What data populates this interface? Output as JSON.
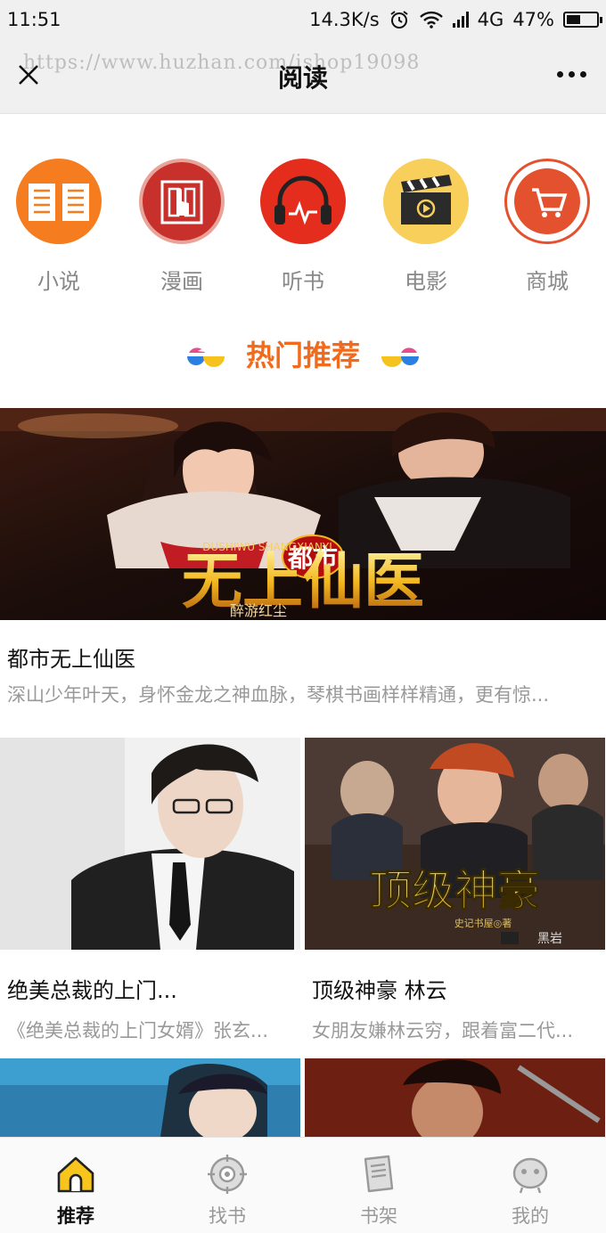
{
  "status_bar": {
    "time": "11:51",
    "speed": "14.3K/s",
    "network": "4G",
    "battery": "47%",
    "battery_level": 0.47
  },
  "header": {
    "title": "阅读",
    "watermark": "https://www.huzhan.com/ishop19098"
  },
  "categories": [
    {
      "label": "小说",
      "icon": "book-icon",
      "color": "#f57c1f"
    },
    {
      "label": "漫画",
      "icon": "comic-icon",
      "color": "#c8302c"
    },
    {
      "label": "听书",
      "icon": "headphones-icon",
      "color": "#e52d1d"
    },
    {
      "label": "电影",
      "icon": "clapperboard-icon",
      "color": "#f8cf5a"
    },
    {
      "label": "商城",
      "icon": "cart-icon",
      "color": "#e4512e"
    }
  ],
  "section": {
    "title": "热门推荐",
    "accent": "#f26a1b"
  },
  "feature": {
    "title": "都市无上仙医",
    "desc": "深山少年叶天，身怀金龙之神血脉，琴棋书画样样精通，更有惊..."
  },
  "books": [
    {
      "title": "绝美总裁的上门...",
      "desc": "《绝美总裁的上门女婿》张玄..."
    },
    {
      "title": "顶级神豪 林云",
      "desc": "女朋友嫌林云穷，跟着富二代..."
    }
  ],
  "bottom_nav": [
    {
      "label": "推荐",
      "icon": "home-icon",
      "active": true
    },
    {
      "label": "找书",
      "icon": "target-icon",
      "active": false
    },
    {
      "label": "书架",
      "icon": "bookshelf-icon",
      "active": false
    },
    {
      "label": "我的",
      "icon": "profile-icon",
      "active": false
    }
  ]
}
